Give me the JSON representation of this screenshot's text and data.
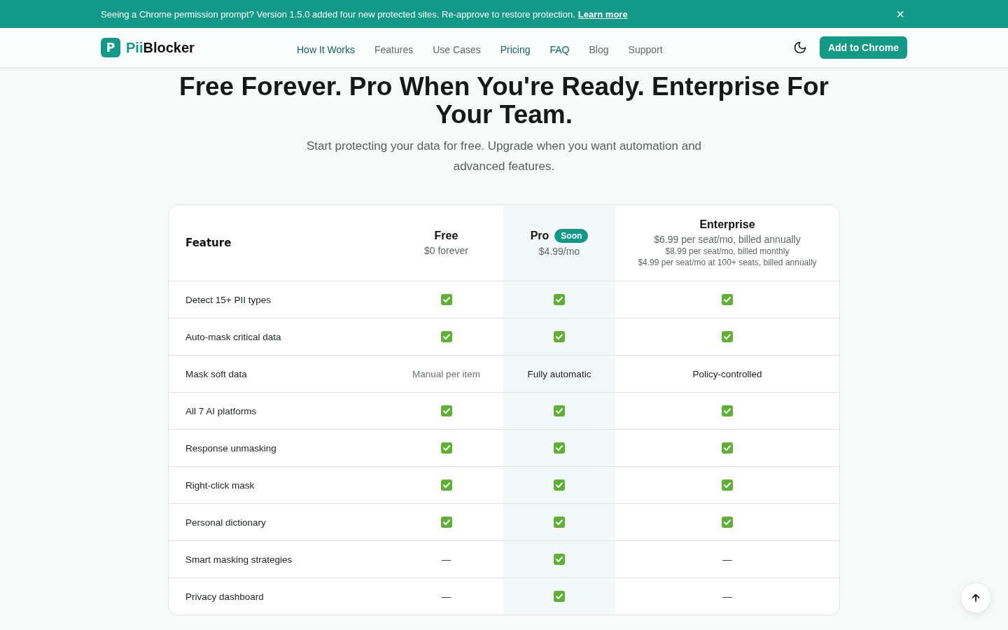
{
  "banner": {
    "message": "Seeing a Chrome permission prompt? Version 1.5.0 added four new protected sites. Re-approve to restore protection.",
    "link": "Learn more",
    "close": "×"
  },
  "nav": {
    "logo_accent": "Pii",
    "logo_rest": "Blocker",
    "logo_mark": "P",
    "links": [
      {
        "label": "How It Works",
        "accent": true
      },
      {
        "label": "Features",
        "accent": false
      },
      {
        "label": "Use Cases",
        "accent": false
      },
      {
        "label": "Pricing",
        "accent": true
      },
      {
        "label": "FAQ",
        "accent": true
      },
      {
        "label": "Blog",
        "accent": false
      },
      {
        "label": "Support",
        "accent": false
      }
    ],
    "cta": "Add to Chrome"
  },
  "hero": {
    "title": "Free Forever. Pro When You're Ready. Enterprise For Your Team.",
    "subtitle": "Start protecting your data for free. Upgrade when you want automation and advanced features."
  },
  "table": {
    "feature_heading": "Feature",
    "plans": [
      {
        "name": "Free",
        "price": "$0 forever",
        "highlighted": false
      },
      {
        "name": "Pro",
        "price": "$4.99/mo",
        "badge": "Soon",
        "highlighted": true
      },
      {
        "name": "Enterprise",
        "price": "$6.99 per seat/mo, billed annually",
        "highlighted": false,
        "notes": [
          "$8.99 per seat/mo, billed monthly",
          "$4.99 per seat/mo at 100+ seats, billed annually"
        ]
      }
    ],
    "rows": [
      {
        "feature": "Detect 15+ PII types",
        "cells": [
          {
            "kind": "check"
          },
          {
            "kind": "check"
          },
          {
            "kind": "check"
          }
        ]
      },
      {
        "feature": "Auto-mask critical data",
        "cells": [
          {
            "kind": "check"
          },
          {
            "kind": "check"
          },
          {
            "kind": "check"
          }
        ]
      },
      {
        "feature": "Mask soft data",
        "cells": [
          {
            "kind": "muted",
            "text": "Manual per item"
          },
          {
            "kind": "text",
            "text": "Fully automatic"
          },
          {
            "kind": "text",
            "text": "Policy-controlled"
          }
        ]
      },
      {
        "feature": "All 7 AI platforms",
        "cells": [
          {
            "kind": "check"
          },
          {
            "kind": "check"
          },
          {
            "kind": "check"
          }
        ]
      },
      {
        "feature": "Response unmasking",
        "cells": [
          {
            "kind": "check"
          },
          {
            "kind": "check"
          },
          {
            "kind": "check"
          }
        ]
      },
      {
        "feature": "Right-click mask",
        "cells": [
          {
            "kind": "check"
          },
          {
            "kind": "check"
          },
          {
            "kind": "check"
          }
        ]
      },
      {
        "feature": "Personal dictionary",
        "cells": [
          {
            "kind": "check"
          },
          {
            "kind": "check"
          },
          {
            "kind": "check"
          }
        ]
      },
      {
        "feature": "Smart masking strategies",
        "cells": [
          {
            "kind": "text",
            "text": "—"
          },
          {
            "kind": "check"
          },
          {
            "kind": "text",
            "text": "—"
          }
        ]
      },
      {
        "feature": "Privacy dashboard",
        "cells": [
          {
            "kind": "text",
            "text": "—"
          },
          {
            "kind": "check"
          },
          {
            "kind": "text",
            "text": "—"
          }
        ]
      }
    ]
  }
}
